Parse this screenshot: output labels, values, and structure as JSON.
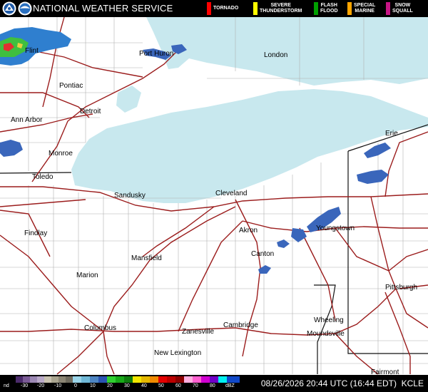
{
  "header": {
    "title": "NATIONAL WEATHER SERVICE",
    "legend": [
      {
        "label": "TORNADO",
        "color": "#ff0000"
      },
      {
        "label": "SEVERE\nTHUNDERSTORM",
        "color": "#ffff00"
      },
      {
        "label": "FLASH\nFLOOD",
        "color": "#00a000"
      },
      {
        "label": "SPECIAL\nMARINE",
        "color": "#ffa500"
      },
      {
        "label": "SNOW\nSQUALL",
        "color": "#c71585"
      }
    ]
  },
  "map": {
    "lake_color": "#c8e8ee",
    "road_color": "#9b1c1c",
    "county_line_color": "#b0b0b0",
    "cities": [
      {
        "name": "Flint"
      },
      {
        "name": "Port Huron"
      },
      {
        "name": "London"
      },
      {
        "name": "Pontiac"
      },
      {
        "name": "Detroit"
      },
      {
        "name": "Ann Arbor"
      },
      {
        "name": "Monroe"
      },
      {
        "name": "Toledo"
      },
      {
        "name": "Sandusky"
      },
      {
        "name": "Cleveland"
      },
      {
        "name": "Erie"
      },
      {
        "name": "Findlay"
      },
      {
        "name": "Akron"
      },
      {
        "name": "Youngstown"
      },
      {
        "name": "Mansfield"
      },
      {
        "name": "Canton"
      },
      {
        "name": "Marion"
      },
      {
        "name": "Pittsburgh"
      },
      {
        "name": "Wheeling"
      },
      {
        "name": "Columbus"
      },
      {
        "name": "Cambridge"
      },
      {
        "name": "Moundsville"
      },
      {
        "name": "Zanesville"
      },
      {
        "name": "New Lexington"
      },
      {
        "name": "Fairmont"
      }
    ]
  },
  "footer": {
    "scale_labels": [
      "nd",
      "-30",
      "-20",
      "-10",
      "0",
      "10",
      "20",
      "30",
      "40",
      "50",
      "60",
      "70",
      "80",
      "dBZ"
    ],
    "timestamp": "08/26/2026 20:44 UTC (16:44 EDT)",
    "station": "KCLE"
  }
}
